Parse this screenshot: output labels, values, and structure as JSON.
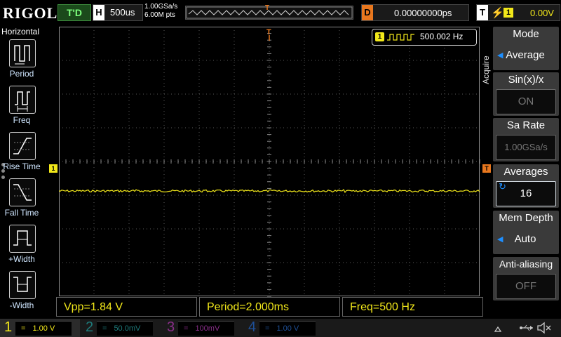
{
  "topbar": {
    "logo": "RIGOL",
    "trigger_status": "T'D",
    "horizontal_tag": "H",
    "timebase": "500us",
    "sample_rate": "1.00GSa/s",
    "memory_points": "6.00M pts",
    "delay_tag": "D",
    "delay_value": "0.00000000ps",
    "trigger_tag": "T",
    "trigger_source": "1",
    "trigger_level": "0.00V",
    "trigger_marker": "T"
  },
  "left_menu": {
    "title": "Horizontal",
    "items": [
      {
        "label": "Period",
        "icon": "period-icon"
      },
      {
        "label": "Freq",
        "icon": "freq-icon"
      },
      {
        "label": "Rise Time",
        "icon": "rise-time-icon"
      },
      {
        "label": "Fall Time",
        "icon": "fall-time-icon"
      },
      {
        "label": "+Width",
        "icon": "positive-width-icon"
      },
      {
        "label": "-Width",
        "icon": "negative-width-icon"
      }
    ]
  },
  "screen": {
    "freq_counter_channel": "1",
    "freq_counter_value": "500.002 Hz",
    "channel_marker": "1",
    "trigger_level_marker": "T"
  },
  "right_menu": {
    "side_label": "Acquire",
    "items": [
      {
        "title": "Mode",
        "value": "Average",
        "state": "lit",
        "arrow": "◀"
      },
      {
        "title": "Sin(x)/x",
        "value": "ON",
        "state": "dim"
      },
      {
        "title": "Sa Rate",
        "value": "1.00GSa/s",
        "state": "dim"
      },
      {
        "title": "Averages",
        "value": "16",
        "state": "lit",
        "arrow": "↻"
      },
      {
        "title": "Mem Depth",
        "value": "Auto",
        "state": "lit",
        "arrow": "◀"
      },
      {
        "title": "Anti-aliasing",
        "value": "OFF",
        "state": "dim"
      }
    ]
  },
  "measurements": {
    "vpp": "Vpp=1.84 V",
    "period": "Period=2.000ms",
    "freq": "Freq=500 Hz"
  },
  "channels": [
    {
      "num": "1",
      "scale": "1.00 V",
      "color": "#f2e81a"
    },
    {
      "num": "2",
      "scale": "50.0mV",
      "color": "#19c2c2"
    },
    {
      "num": "3",
      "scale": "100mV",
      "color": "#c23ec2"
    },
    {
      "num": "4",
      "scale": "1.00 V",
      "color": "#1e6fd9"
    }
  ],
  "colors": {
    "ch1": "#f2e81a",
    "trigger": "#e8771e",
    "grid": "#5a5a5a",
    "menu_bg": "#3a3a3a"
  }
}
